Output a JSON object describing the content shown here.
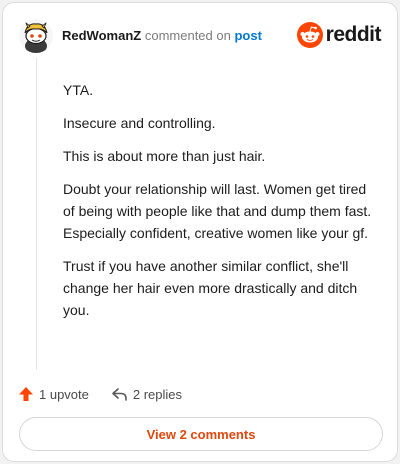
{
  "comment": {
    "author": "RedWomanZ",
    "action_text": "commented on",
    "target_link": "post",
    "paragraphs": [
      "YTA.",
      "Insecure and controlling.",
      "This is about more than just hair.",
      "Doubt your relationship will last. Women get tired of being with people like that and dump them fast. Especially confident, creative women like your gf.",
      "Trust if you have another similar conflict, she'll change her hair even more drastically and ditch you."
    ]
  },
  "brand": {
    "name": "reddit",
    "color": "#ff4500"
  },
  "actions": {
    "upvote_label": "1 upvote",
    "replies_label": "2 replies"
  },
  "footer": {
    "view_comments_label": "View 2 comments"
  },
  "colors": {
    "accent": "#e0480d",
    "link": "#0079d3",
    "upvote": "#ff4500"
  },
  "icons": [
    "avatar-snoo-icon",
    "reddit-logo-icon",
    "upvote-arrow-icon",
    "reply-arrow-icon"
  ]
}
